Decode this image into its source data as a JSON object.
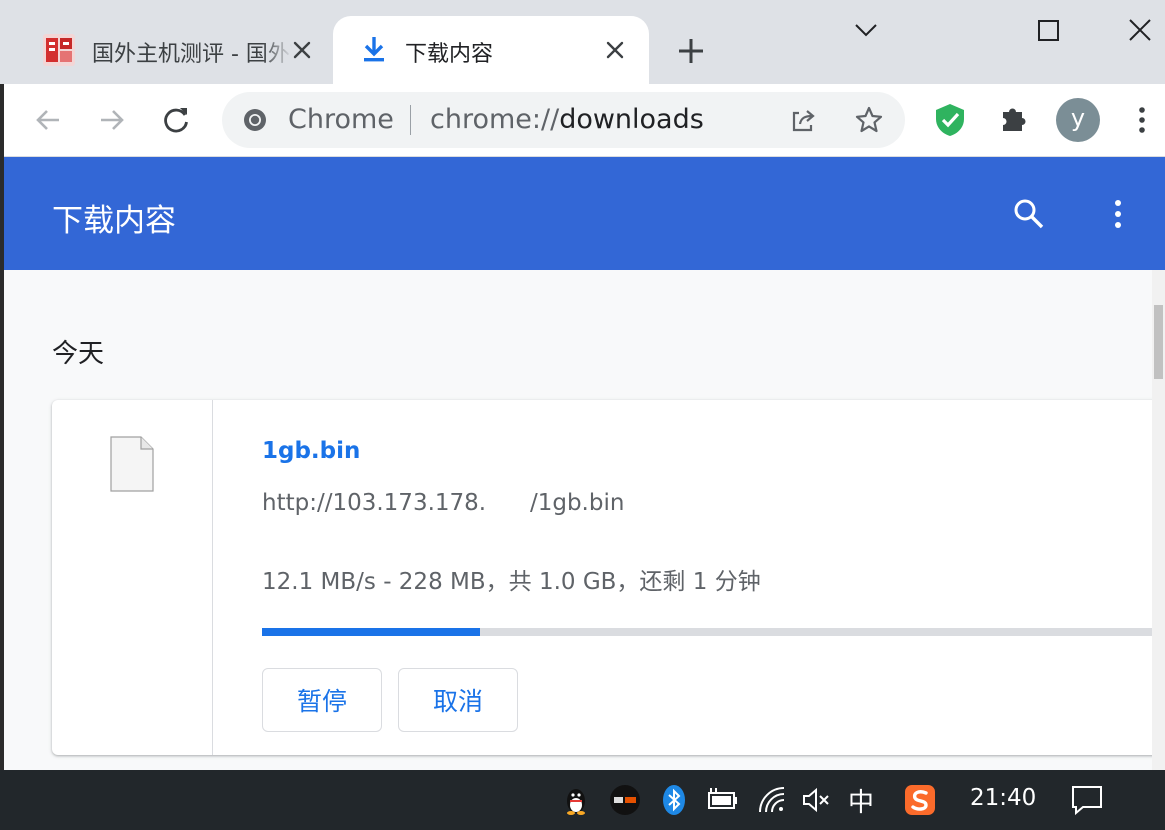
{
  "tabs": [
    {
      "title": "国外主机测评 - 国外VPS，国外服务器，国外主机，测评及优惠码",
      "active": false
    },
    {
      "title": "下载内容",
      "active": true
    }
  ],
  "omnibox": {
    "chip": "Chrome",
    "url_scheme": "chrome://",
    "url_host": "downloads"
  },
  "profile": {
    "initial": "y",
    "color": "#7b8e96"
  },
  "downloads_page": {
    "title": "下载内容",
    "section_date": "今天",
    "item": {
      "file_name": "1gb.bin",
      "url": "http://103.173.178.      /1gb.bin",
      "status": "12.1 MB/s - 228 MB，共 1.0 GB，还剩 1 分钟",
      "progress_percent": 24,
      "pause_label": "暂停",
      "cancel_label": "取消"
    }
  },
  "colors": {
    "appbar": "#3367d6",
    "accent": "#1a73e8",
    "taskbar": "#22272b"
  },
  "taskbar": {
    "ime": "中",
    "clock": "21:40"
  }
}
